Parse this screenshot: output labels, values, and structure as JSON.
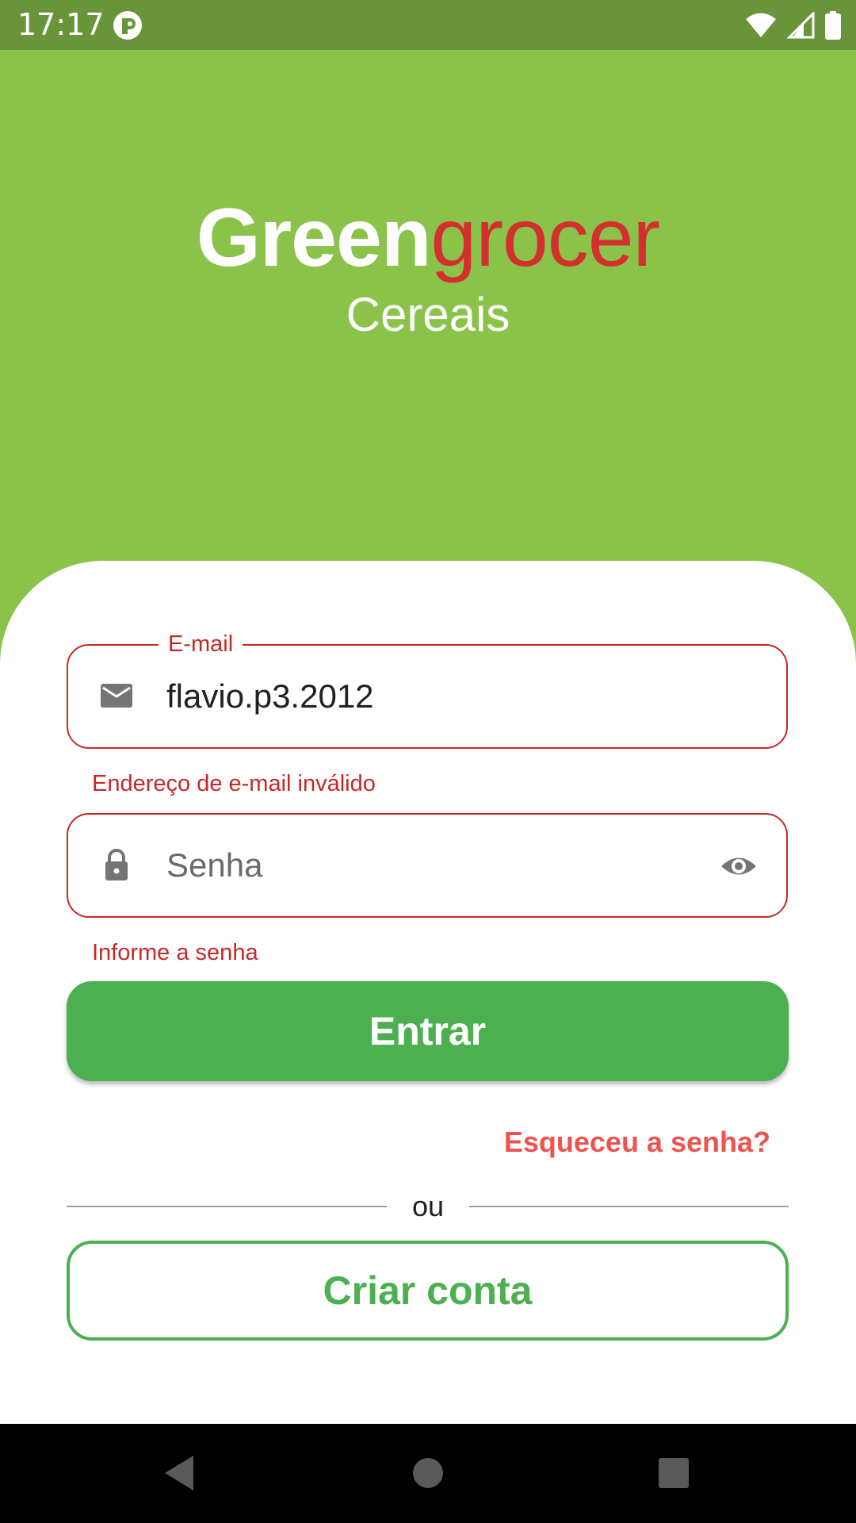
{
  "status_bar": {
    "time": "17:17",
    "icons": [
      "app-notification-icon",
      "wifi-icon",
      "signal-icon",
      "battery-icon"
    ]
  },
  "header": {
    "brand_part1": "Green",
    "brand_part2": "grocer",
    "category": "Cereais"
  },
  "form": {
    "email": {
      "label": "E-mail",
      "value": "flavio.p3.2012",
      "error": "Endereço de e-mail inválido",
      "icon": "email-icon"
    },
    "password": {
      "placeholder": "Senha",
      "error": "Informe a senha",
      "icon": "lock-icon",
      "toggle_icon": "eye-icon"
    },
    "login_button": "Entrar",
    "forgot_password": "Esqueceu a senha?",
    "divider_text": "ou",
    "create_account_button": "Criar conta"
  },
  "navigation_bar": {
    "icons": [
      "back-icon",
      "home-icon",
      "recents-icon"
    ]
  },
  "colors": {
    "header_background": "#8bc34a",
    "status_bar": "#6a943a",
    "primary_green": "#4caf50",
    "error_red": "#c62828",
    "brand_red": "#d32f2f",
    "link_red": "#ef5350"
  }
}
